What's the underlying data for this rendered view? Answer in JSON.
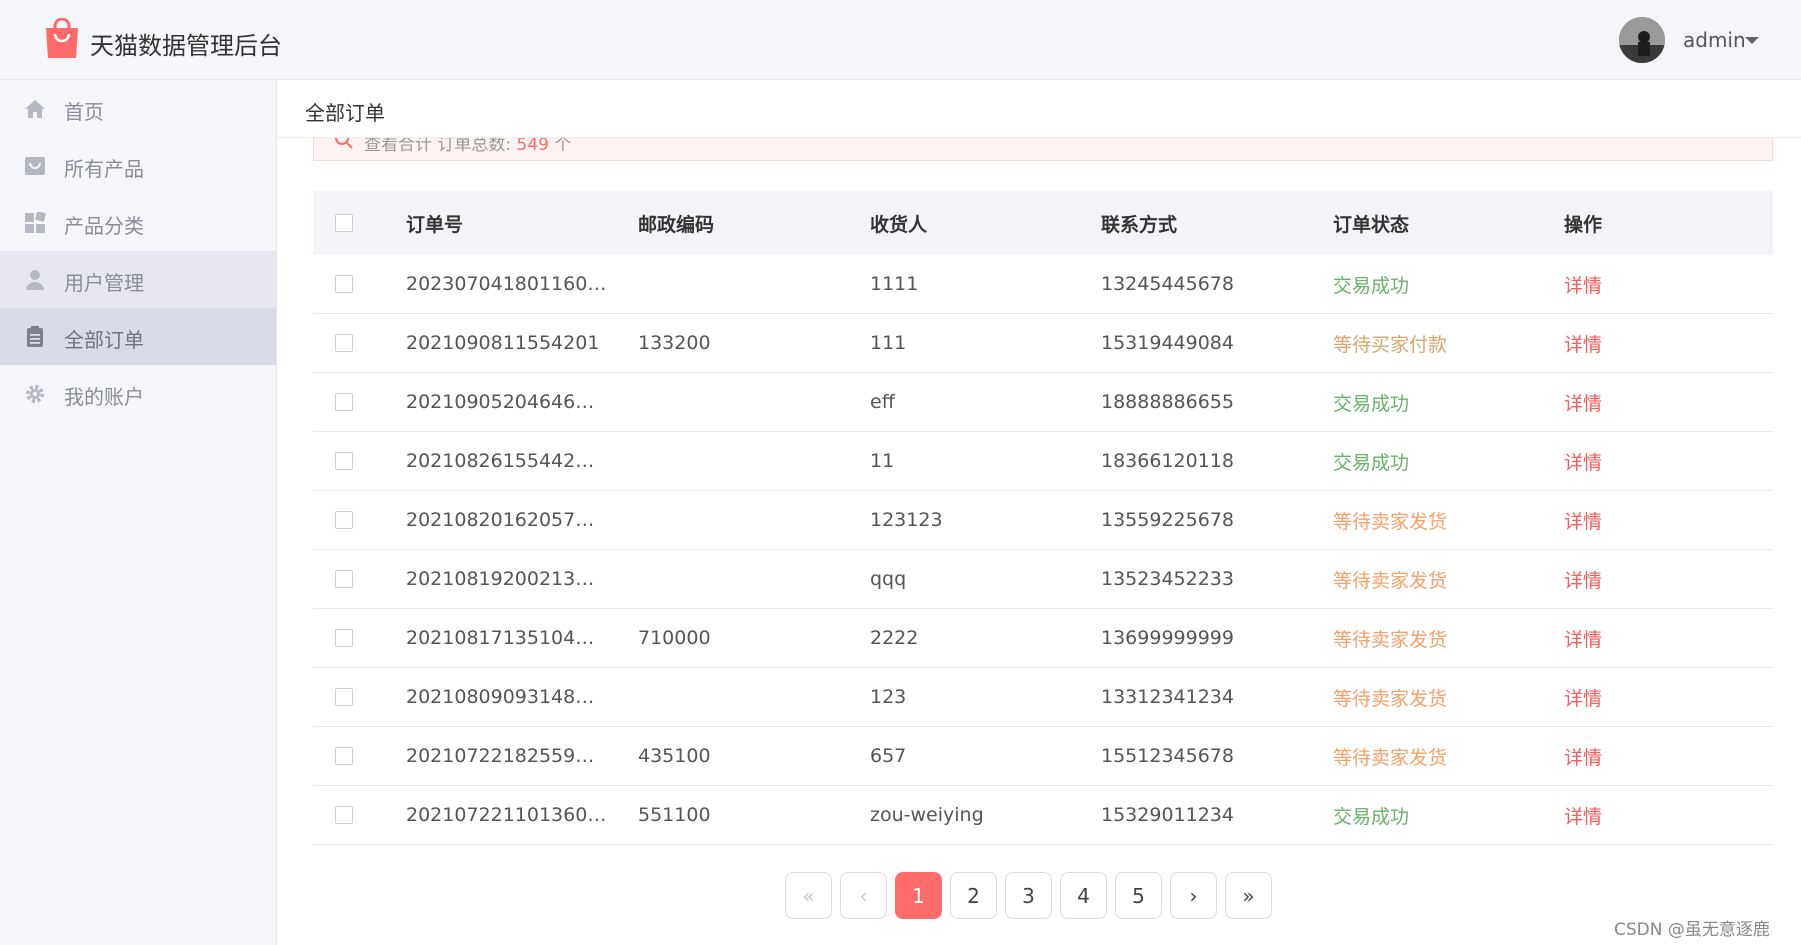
{
  "header": {
    "app_title": "天猫数据管理后台",
    "user_name": "admin",
    "brand_color": "#ff6b6b"
  },
  "sidebar": {
    "items": [
      {
        "label": "首页",
        "icon": "home-icon"
      },
      {
        "label": "所有产品",
        "icon": "shopping-bag-icon"
      },
      {
        "label": "产品分类",
        "icon": "grid-icon"
      },
      {
        "label": "用户管理",
        "icon": "user-icon"
      },
      {
        "label": "全部订单",
        "icon": "clipboard-icon"
      },
      {
        "label": "我的账户",
        "icon": "gear-icon"
      }
    ]
  },
  "main": {
    "page_title": "全部订单",
    "summary": {
      "prefix": "查看合计  订单总数: ",
      "count": "549",
      "suffix": " 个"
    },
    "table": {
      "headers": {
        "order_no": "订单号",
        "zip": "邮政编码",
        "receiver": "收货人",
        "phone": "联系方式",
        "status": "订单状态",
        "op": "操作"
      },
      "rows": [
        {
          "order_no": "202307041801160…",
          "zip": "",
          "receiver": "1111",
          "phone": "13245445678",
          "status": "交易成功",
          "op": "详情"
        },
        {
          "order_no": "2021090811554201",
          "zip": "133200",
          "receiver": "111",
          "phone": "15319449084",
          "status": "等待买家付款",
          "op": "详情"
        },
        {
          "order_no": "20210905204646…",
          "zip": "",
          "receiver": "eff",
          "phone": "18888886655",
          "status": "交易成功",
          "op": "详情"
        },
        {
          "order_no": "20210826155442…",
          "zip": "",
          "receiver": "11",
          "phone": "18366120118",
          "status": "交易成功",
          "op": "详情"
        },
        {
          "order_no": "20210820162057…",
          "zip": "",
          "receiver": "123123",
          "phone": "13559225678",
          "status": "等待卖家发货",
          "op": "详情"
        },
        {
          "order_no": "20210819200213…",
          "zip": "",
          "receiver": "qqq",
          "phone": "13523452233",
          "status": "等待卖家发货",
          "op": "详情"
        },
        {
          "order_no": "20210817135104…",
          "zip": "710000",
          "receiver": "2222",
          "phone": "13699999999",
          "status": "等待卖家发货",
          "op": "详情"
        },
        {
          "order_no": "20210809093148…",
          "zip": "",
          "receiver": "123",
          "phone": "13312341234",
          "status": "等待卖家发货",
          "op": "详情"
        },
        {
          "order_no": "20210722182559…",
          "zip": "435100",
          "receiver": "657",
          "phone": "15512345678",
          "status": "等待卖家发货",
          "op": "详情"
        },
        {
          "order_no": "202107221101360…",
          "zip": "551100",
          "receiver": "zou-weiying",
          "phone": "15329011234",
          "status": "交易成功",
          "op": "详情"
        }
      ]
    },
    "pagination": {
      "first": "«",
      "prev": "‹",
      "pages": [
        "1",
        "2",
        "3",
        "4",
        "5"
      ],
      "next": "›",
      "last": "»",
      "current": "1"
    }
  },
  "watermark": "CSDN @虽无意逐鹿"
}
